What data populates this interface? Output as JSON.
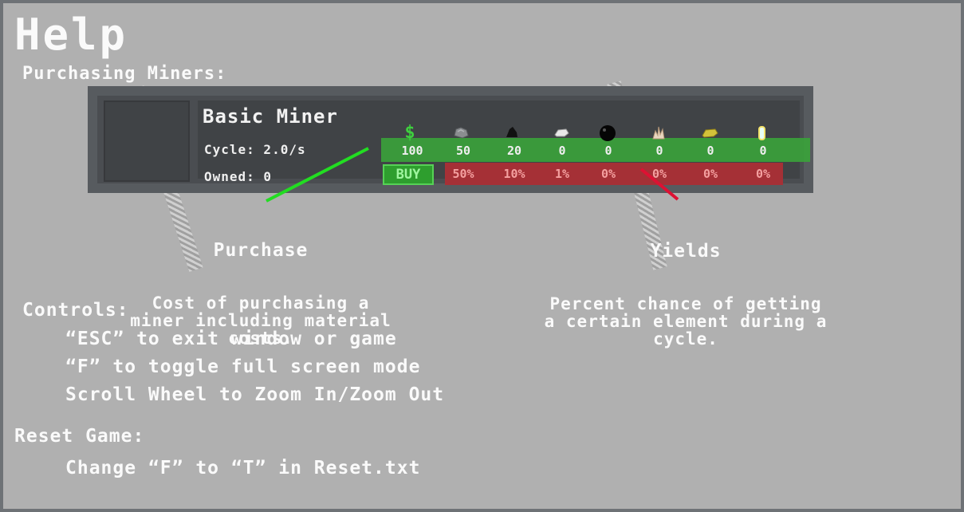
{
  "title": "Help",
  "purchasing_heading": "Purchasing Miners:",
  "miner": {
    "name": "Basic Miner",
    "cycle_label": "Cycle: 2.0/s",
    "owned_label": "Owned: 0",
    "buy_label": "BUY",
    "resource_icons": [
      "dollar-icon",
      "stone-icon",
      "coal-icon",
      "iron-icon",
      "black-orb-icon",
      "quartz-icon",
      "gold-icon",
      "crystal-icon"
    ],
    "dollar_symbol": "$",
    "costs": [
      "100",
      "50",
      "20",
      "0",
      "0",
      "0",
      "0",
      "0"
    ],
    "yields": [
      "50%",
      "10%",
      "1%",
      "0%",
      "0%",
      "0%",
      "0%"
    ]
  },
  "callouts": {
    "purchase_title": "Purchase",
    "purchase_text": "Cost of purchasing a\nminer including material\ncosts.",
    "yields_title": "Yields",
    "yields_text": "Percent chance of getting\na certain element during a\ncycle."
  },
  "controls": {
    "heading": "Controls:",
    "lines": [
      "“ESC” to exit window or game",
      "“F” to toggle full screen mode",
      "Scroll Wheel to Zoom In/Zoom Out"
    ]
  },
  "reset": {
    "heading": "Reset Game:",
    "line": "Change “F” to “T” in Reset.txt"
  },
  "colors": {
    "background": "#b0b0b0",
    "cost_band": "#3aa33a",
    "yield_band": "#a53036",
    "purchase_pointer": "#22dd22",
    "yield_pointer": "#dd1133"
  }
}
